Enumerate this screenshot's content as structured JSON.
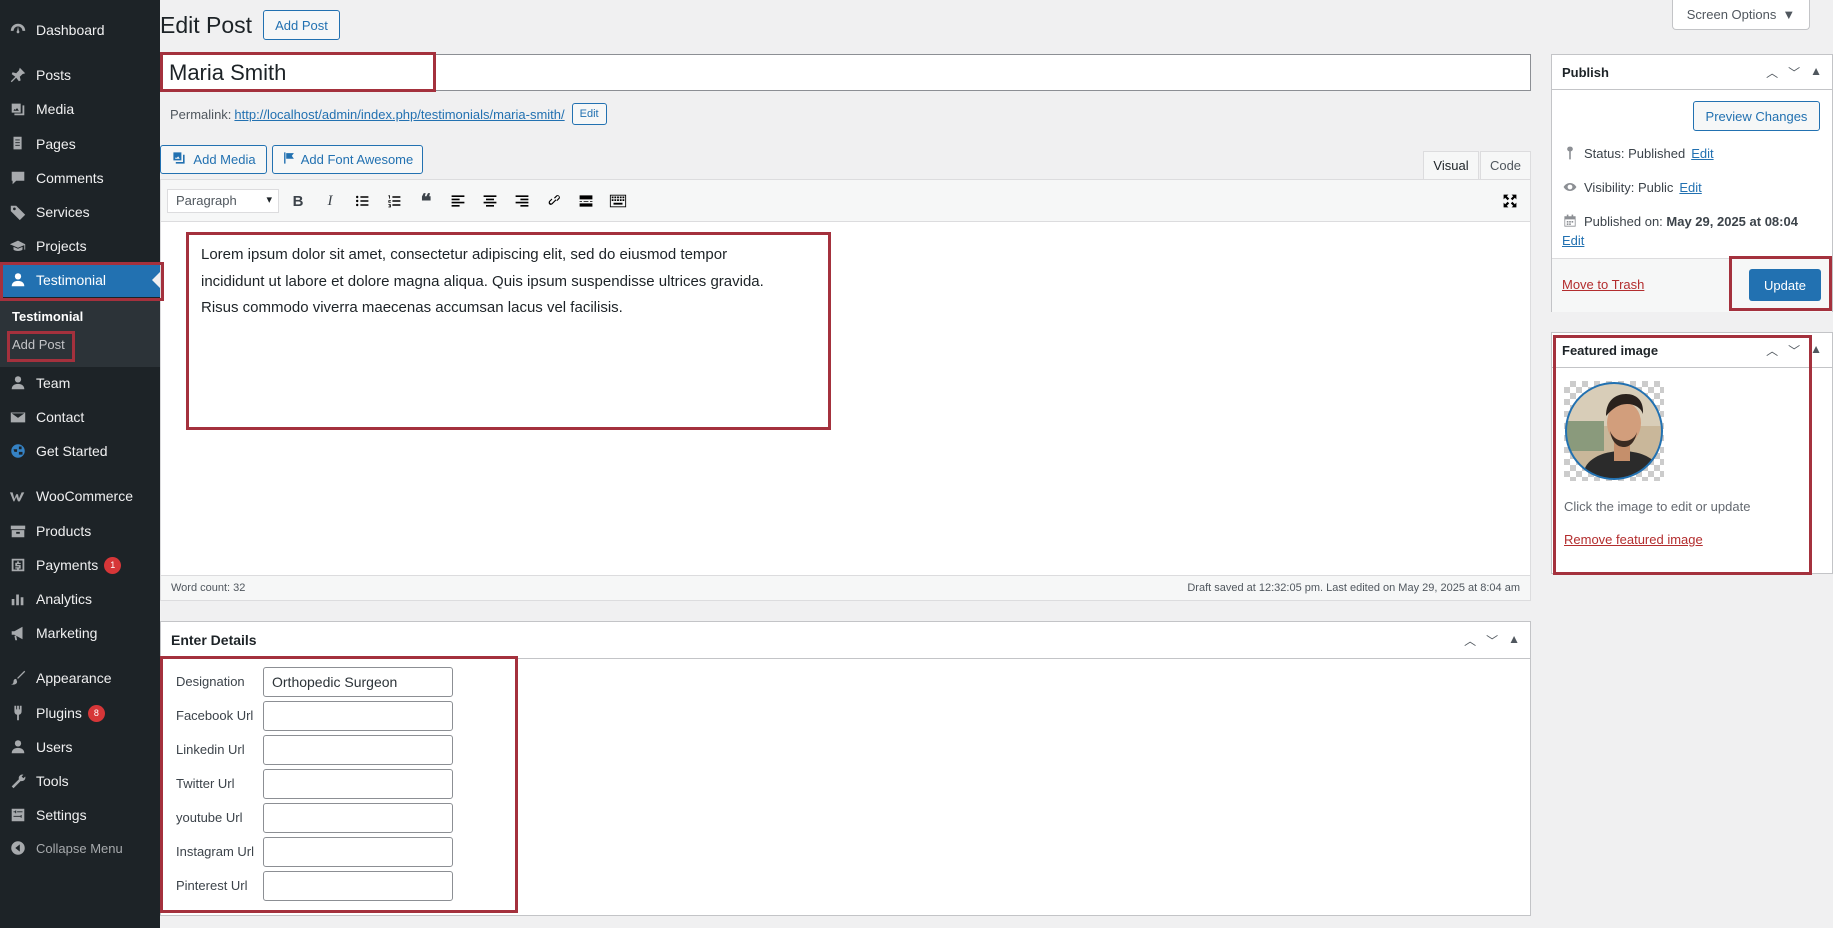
{
  "sidebar": {
    "items": [
      {
        "label": "Dashboard",
        "icon": "dashboard-icon"
      },
      {
        "label": "Posts",
        "icon": "pin-icon"
      },
      {
        "label": "Media",
        "icon": "media-icon"
      },
      {
        "label": "Pages",
        "icon": "pages-icon"
      },
      {
        "label": "Comments",
        "icon": "comments-icon"
      },
      {
        "label": "Services",
        "icon": "tag-icon"
      },
      {
        "label": "Projects",
        "icon": "graduation-cap-icon"
      },
      {
        "label": "Testimonial",
        "icon": "user-icon"
      },
      {
        "label": "Team",
        "icon": "user-icon"
      },
      {
        "label": "Contact",
        "icon": "envelope-icon"
      },
      {
        "label": "Get Started",
        "icon": "globe-icon"
      },
      {
        "label": "WooCommerce",
        "icon": "woo-icon"
      },
      {
        "label": "Products",
        "icon": "archive-icon"
      },
      {
        "label": "Payments",
        "icon": "dollar-icon",
        "badge": "1"
      },
      {
        "label": "Analytics",
        "icon": "bar-chart-icon"
      },
      {
        "label": "Marketing",
        "icon": "megaphone-icon"
      },
      {
        "label": "Appearance",
        "icon": "paintbrush-icon"
      },
      {
        "label": "Plugins",
        "icon": "plug-icon",
        "badge": "8"
      },
      {
        "label": "Users",
        "icon": "users-icon"
      },
      {
        "label": "Tools",
        "icon": "wrench-icon"
      },
      {
        "label": "Settings",
        "icon": "settings-icon"
      },
      {
        "label": "Collapse Menu",
        "icon": "collapse-icon"
      }
    ],
    "submenu": {
      "current": "Testimonial",
      "add": "Add Post"
    }
  },
  "header": {
    "title": "Edit Post",
    "add_button": "Add Post",
    "screen_options": "Screen Options"
  },
  "post": {
    "title": "Maria Smith",
    "permalink_label": "Permalink:",
    "permalink_url": "http://localhost/admin/index.php/testimonials/maria-smith/",
    "permalink_edit": "Edit"
  },
  "editor": {
    "add_media": "Add Media",
    "add_font_awesome": "Add Font Awesome",
    "tab_visual": "Visual",
    "tab_code": "Code",
    "format": "Paragraph",
    "content": "Lorem ipsum dolor sit amet, consectetur adipiscing elit, sed do eiusmod tempor incididunt ut labore et dolore magna aliqua. Quis ipsum suspendisse ultrices gravida. Risus commodo viverra maecenas accumsan lacus vel facilisis.",
    "word_count": "Word count: 32",
    "draft_saved": "Draft saved at 12:32:05 pm. Last edited on May 29, 2025 at 8:04 am"
  },
  "details": {
    "title": "Enter Details",
    "fields": [
      {
        "label": "Designation",
        "value": "Orthopedic Surgeon"
      },
      {
        "label": "Facebook Url",
        "value": ""
      },
      {
        "label": "Linkedin Url",
        "value": ""
      },
      {
        "label": "Twitter Url",
        "value": ""
      },
      {
        "label": "youtube Url",
        "value": ""
      },
      {
        "label": "Instagram Url",
        "value": ""
      },
      {
        "label": "Pinterest Url",
        "value": ""
      }
    ]
  },
  "publish": {
    "title": "Publish",
    "preview": "Preview Changes",
    "status_label": "Status:",
    "status_value": "Published",
    "visibility_label": "Visibility:",
    "visibility_value": "Public",
    "published_label": "Published on:",
    "published_value": "May 29, 2025 at 08:04",
    "edit": "Edit",
    "trash": "Move to Trash",
    "update": "Update"
  },
  "featured": {
    "title": "Featured image",
    "hint": "Click the image to edit or update",
    "remove": "Remove featured image"
  },
  "colors": {
    "accent": "#2271b1",
    "sidebar": "#1d2327",
    "highlight": "#a4313d",
    "badge": "#d63638"
  }
}
